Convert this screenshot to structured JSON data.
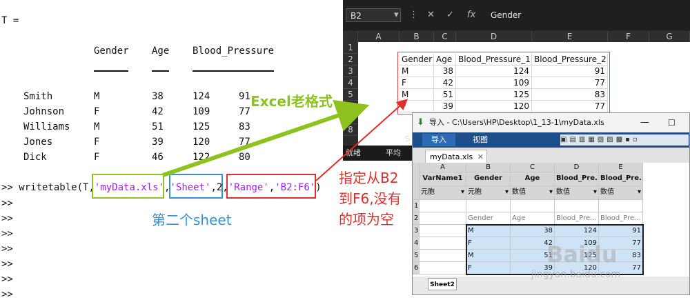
{
  "console": {
    "var_header": "T =",
    "columns": [
      "Gender",
      "Age",
      "Blood_Pressure"
    ],
    "rows": [
      {
        "name": "Smith",
        "gender": "M",
        "age": "38",
        "bp1": "124",
        "bp2": "91"
      },
      {
        "name": "Johnson",
        "gender": "F",
        "age": "42",
        "bp1": "109",
        "bp2": "77"
      },
      {
        "name": "Williams",
        "gender": "M",
        "age": "51",
        "bp1": "125",
        "bp2": "83"
      },
      {
        "name": "Jones",
        "gender": "F",
        "age": "39",
        "bp1": "120",
        "bp2": "77"
      },
      {
        "name": "Dick",
        "gender": "F",
        "age": "46",
        "bp1": "122",
        "bp2": "80"
      }
    ],
    "prompt": ">>",
    "command": {
      "prefix": "writetable(T,",
      "filename": "'myData.xls'",
      "comma1": ",",
      "sheet_key": "'Sheet'",
      "sheet_num": ",2,",
      "range_key": "'Range'",
      "comma2": ",",
      "range_val": "'B2:F6'",
      "suffix": ")"
    }
  },
  "annotations": {
    "excel_format": "Excel老格式",
    "second_sheet": "第二个sheet",
    "range_note_lines": [
      "指定从B2",
      "到F6,没有",
      "的项为空"
    ]
  },
  "colors": {
    "green": "#8dc21f",
    "blue": "#3b8fd6",
    "red": "#e02d2d",
    "purple": "#a020f0"
  },
  "excel": {
    "name_box": "B2",
    "formula_value": "Gender",
    "fx_icon": "fx",
    "col_headers": [
      "A",
      "B",
      "C",
      "D",
      "E",
      "F",
      "G"
    ],
    "row_headers": [
      "1",
      "2",
      "3",
      "4",
      "5",
      "6",
      "7",
      "8"
    ],
    "header_row": [
      "Gender",
      "Age",
      "Blood_Pressure_1",
      "Blood_Pressure_2"
    ],
    "data_rows": [
      [
        "M",
        "38",
        "124",
        "91"
      ],
      [
        "F",
        "42",
        "109",
        "77"
      ],
      [
        "M",
        "51",
        "125",
        "83"
      ],
      [
        "F",
        "39",
        "120",
        "77"
      ]
    ],
    "status_ready": "就绪",
    "status_avg": "平均",
    "sheet_tab_stub": "S"
  },
  "variables_window": {
    "title": "导入 - C:\\Users\\HP\\Desktop\\1_13-1\\myData.xls",
    "tabs": [
      "导入",
      "视图"
    ],
    "doc_tab": "myData.xls",
    "col_letters": [
      "A",
      "B",
      "C",
      "D",
      "E"
    ],
    "col_names": [
      "VarName1",
      "Gender",
      "Age",
      "Blood_Pre...",
      "Blood_Pre..."
    ],
    "col_types": [
      "元胞",
      "元胞",
      "数值",
      "数值",
      "数值"
    ],
    "row2": [
      "",
      "Gender",
      "Age",
      "Blood_Pre...",
      "Blood_Pre..."
    ],
    "rows": [
      {
        "num": "3",
        "cells": [
          "",
          "M",
          "38",
          "124",
          "91"
        ]
      },
      {
        "num": "4",
        "cells": [
          "",
          "F",
          "42",
          "109",
          "77"
        ]
      },
      {
        "num": "5",
        "cells": [
          "",
          "M",
          "51",
          "125",
          "83"
        ]
      },
      {
        "num": "6",
        "cells": [
          "",
          "F",
          "39",
          "120",
          "77"
        ]
      }
    ],
    "row_nums_top": [
      "1",
      "2"
    ],
    "sheet_tab": "Sheet2"
  },
  "watermark": {
    "brand": "Baidu",
    "url": "jingyan.baidu.com"
  }
}
